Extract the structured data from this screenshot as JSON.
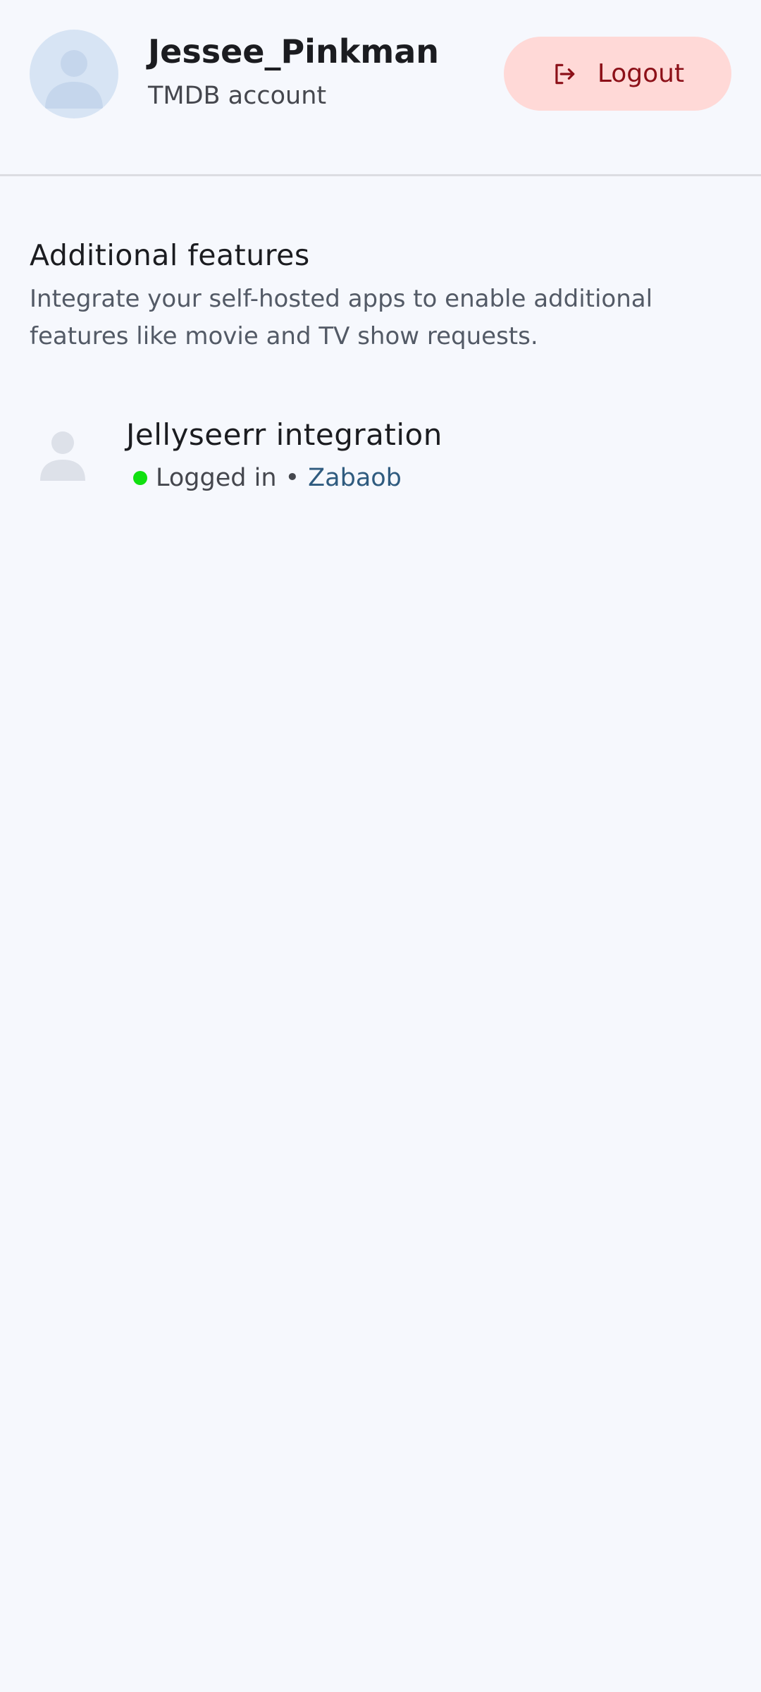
{
  "profile": {
    "username": "Jessee_Pinkman",
    "account_type": "TMDB account",
    "avatar_icon": "person-icon"
  },
  "logout": {
    "label": "Logout",
    "icon": "logout-icon"
  },
  "features": {
    "title": "Additional features",
    "description": "Integrate your self-hosted apps to enable additional features like movie and TV show requests."
  },
  "integration": {
    "title": "Jellyseerr integration",
    "status": "Logged in",
    "separator": "•",
    "user": "Zabaob",
    "icon": "person-icon"
  },
  "colors": {
    "background": "#f6f8fd",
    "logout_bg": "#ffd9d7",
    "logout_text": "#8c1018",
    "status_dot": "#10e010",
    "link_user": "#2f5b7f"
  }
}
